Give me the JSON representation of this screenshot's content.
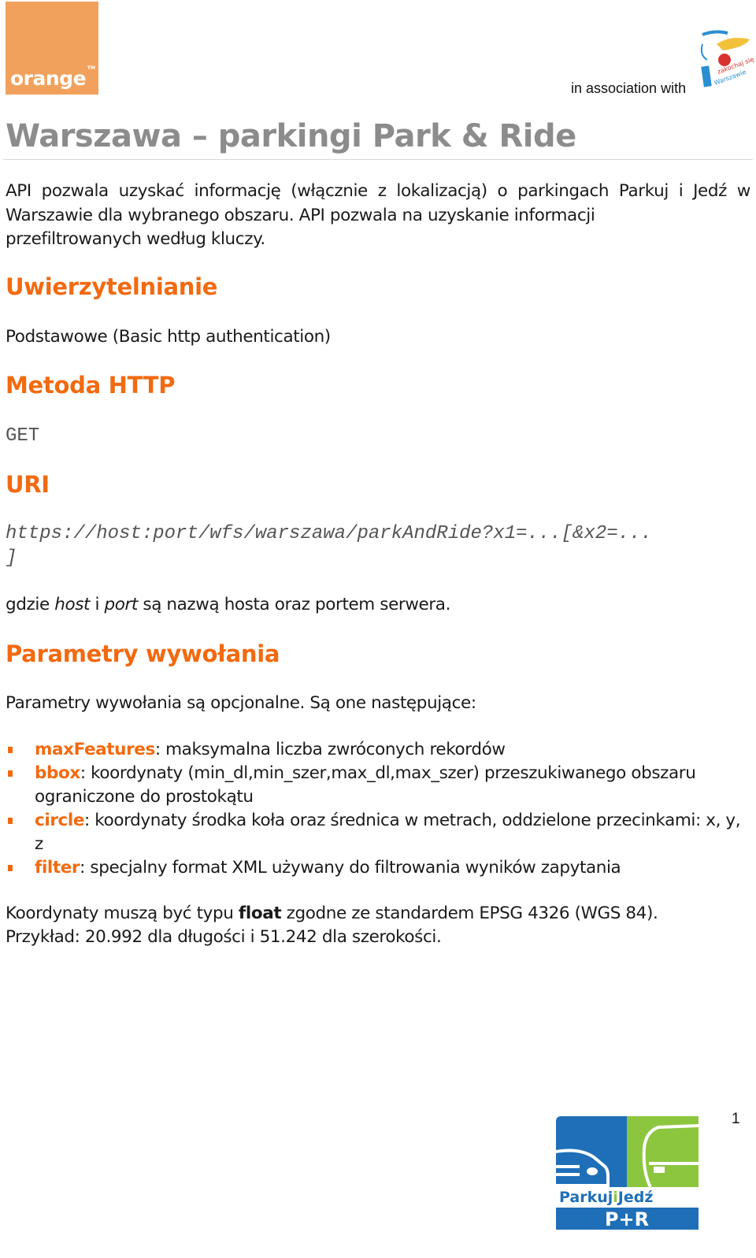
{
  "header": {
    "orange_logo_text": "orange",
    "orange_logo_tm": "TM",
    "association_text": "in association with",
    "partner_logo_text": "zakochaj się w Warszawie",
    "brand_color": "#f2a15c"
  },
  "title": "Warszawa – parkingi Park & Ride",
  "intro": {
    "line1": "API pozwala uzyskać informację (włącznie z lokalizacją) o parkingach Parkuj i Jedź w Warszawie dla wybranego obszaru. API pozwala na uzyskanie informacji",
    "line2": "przefiltrowanych według kluczy."
  },
  "sections": {
    "auth": {
      "heading": "Uwierzytelnianie",
      "text": "Podstawowe (Basic http authentication)"
    },
    "method": {
      "heading": "Metoda HTTP",
      "text": "GET"
    },
    "uri": {
      "heading": "URI",
      "url_line1": "https://host:port/wfs/warszawa/parkAndRide?x1=...[&x2=...",
      "url_line2": "]",
      "note_prefix": "gdzie ",
      "note_host": "host",
      "note_mid": " i ",
      "note_port": "port",
      "note_suffix": " są nazwą hosta oraz portem serwera."
    },
    "params": {
      "heading": "Parametry wywołania",
      "intro": "Parametry wywołania są opcjonalne. Są one następujące:",
      "items": [
        {
          "key": "maxFeatures",
          "desc": ": maksymalna liczba zwróconych rekordów"
        },
        {
          "key": "bbox",
          "desc": ": koordynaty (min_dl,min_szer,max_dl,max_szer) przeszukiwanego obszaru ograniczone do prostokątu"
        },
        {
          "key": "circle",
          "desc": ": koordynaty środka koła oraz średnica w metrach, oddzielone przecinkami: x, y, z"
        },
        {
          "key": "filter",
          "desc": ": specjalny format XML używany do filtrowania wyników zapytania"
        }
      ],
      "accent_color": "#f26a10"
    },
    "coords": {
      "pre": "Koordynaty muszą być typu ",
      "bold": "float",
      "post": " zgodne ze standardem EPSG 4326 (WGS 84).",
      "line2": "Przykład: 20.992 dla długości i 51.242 dla szerokości."
    }
  },
  "footer": {
    "page_number": "1",
    "pr_logo": {
      "word1": "Parkuj",
      "word2": "i",
      "word3": "Jedź",
      "badge": "P+R",
      "blue": "#1e6fb8",
      "green": "#8cc63f"
    }
  }
}
